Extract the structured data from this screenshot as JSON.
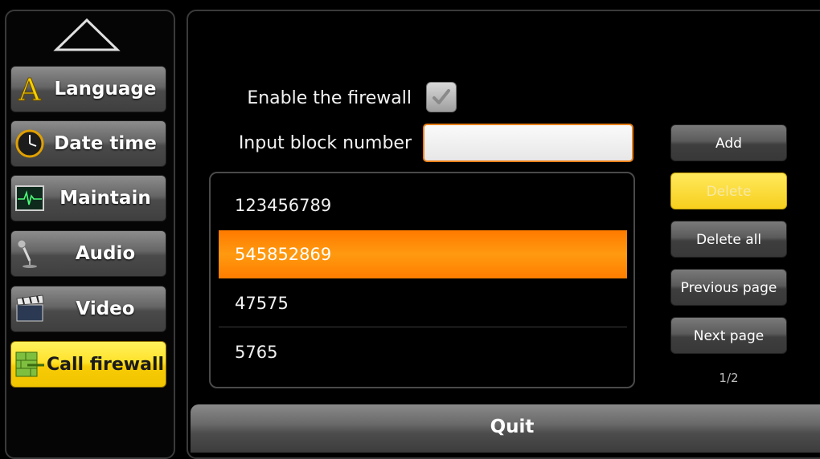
{
  "sidebar": {
    "items": [
      {
        "label": "Language",
        "icon": "language-letter-a-icon"
      },
      {
        "label": "Date time",
        "icon": "clock-icon"
      },
      {
        "label": "Maintain",
        "icon": "monitor-waveform-icon"
      },
      {
        "label": "Audio",
        "icon": "microphone-icon"
      },
      {
        "label": "Video",
        "icon": "clapperboard-icon"
      },
      {
        "label": "Call firewall",
        "icon": "firewall-brick-icon",
        "active": true
      }
    ]
  },
  "form": {
    "enable_label": "Enable the firewall",
    "enable_checked": true,
    "input_label": "Input block number",
    "input_value": "",
    "input_placeholder": ""
  },
  "list": {
    "items": [
      "123456789",
      "545852869",
      "47575",
      "5765"
    ],
    "selected_index": 1
  },
  "buttons": {
    "add": "Add",
    "delete": "Delete",
    "delete_all": "Delete all",
    "previous_page": "Previous page",
    "next_page": "Next page"
  },
  "pagination": "1/2",
  "quit": "Quit",
  "colors": {
    "active_nav": "#ffe22a",
    "selected_row": "#ff8a00",
    "input_border": "#e8801a",
    "delete_button": "#f7d43a"
  }
}
